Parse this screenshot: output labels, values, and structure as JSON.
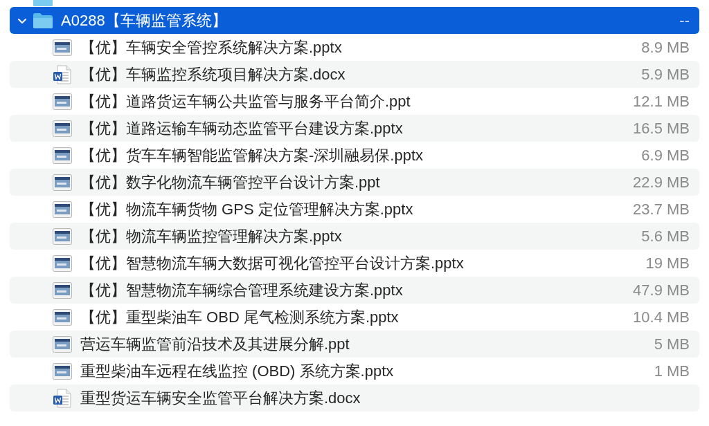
{
  "items": [
    {
      "kind": "folder"
    },
    {
      "kind": "folder",
      "name": "A0288【车辆监管系统】",
      "size": "--",
      "selected": true,
      "expanded": true,
      "children": [
        {
          "kind": "slide",
          "name": "【优】车辆安全管控系统解决方案.pptx",
          "size": "8.9 MB",
          "selected": false
        },
        {
          "kind": "word",
          "name": "【优】车辆监控系统项目解决方案.docx",
          "size": "5.9 MB",
          "selected": false
        },
        {
          "kind": "slide",
          "name": "【优】道路货运车辆公共监管与服务平台简介.ppt",
          "size": "12.1 MB",
          "selected": false
        },
        {
          "kind": "slide",
          "name": "【优】道路运输车辆动态监管平台建设方案.pptx",
          "size": "16.5 MB",
          "selected": false
        },
        {
          "kind": "slide",
          "name": "【优】货车车辆智能监管解决方案-深圳融易保.pptx",
          "size": "6.9 MB",
          "selected": false
        },
        {
          "kind": "slide",
          "name": "【优】数字化物流车辆管控平台设计方案.ppt",
          "size": "22.9 MB",
          "selected": false
        },
        {
          "kind": "slide",
          "name": "【优】物流车辆货物 GPS 定位管理解决方案.pptx",
          "size": "23.7 MB",
          "selected": false
        },
        {
          "kind": "slide",
          "name": "【优】物流车辆监控管理解决方案.pptx",
          "size": "5.6 MB",
          "selected": false
        },
        {
          "kind": "slide",
          "name": "【优】智慧物流车辆大数据可视化管控平台设计方案.pptx",
          "size": "19 MB",
          "selected": false
        },
        {
          "kind": "slide",
          "name": "【优】智慧物流车辆综合管理系统建设方案.pptx",
          "size": "47.9 MB",
          "selected": false
        },
        {
          "kind": "slide",
          "name": "【优】重型柴油车 OBD 尾气检测系统方案.pptx",
          "size": "10.4 MB",
          "selected": false
        },
        {
          "kind": "slide",
          "name": "营运车辆监管前沿技术及其进展分解.ppt",
          "size": "5 MB",
          "selected": false
        },
        {
          "kind": "slide",
          "name": "重型柴油车远程在线监控 (OBD) 系统方案.pptx",
          "size": "1 MB",
          "selected": false
        },
        {
          "kind": "word",
          "name": "重型货运车辆安全监管平台解决方案.docx",
          "selected": false
        }
      ]
    }
  ]
}
